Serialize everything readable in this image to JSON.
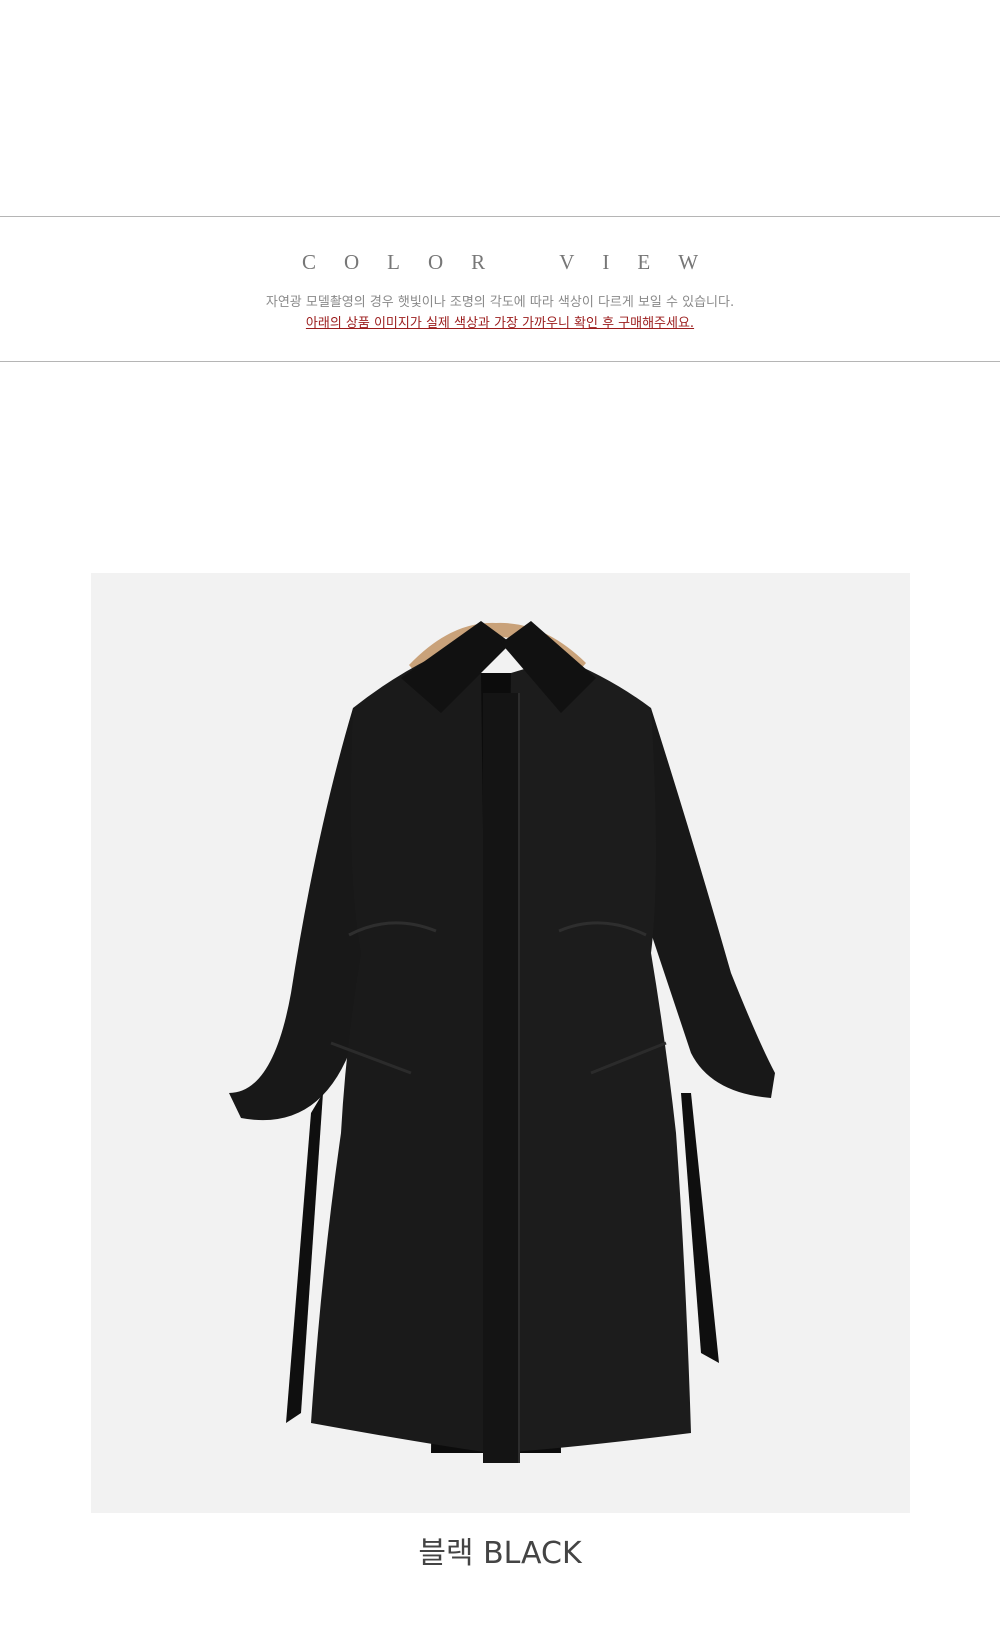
{
  "section": {
    "heading_words": [
      [
        "C",
        "O",
        "L",
        "O",
        "R"
      ],
      [
        "V",
        "I",
        "E",
        "W"
      ]
    ],
    "note_line1": "자연광 모델촬영의 경우 햇빛이나 조명의 각도에 따라 색상이 다르게 보일 수 있습니다.",
    "note_line2": "아래의 상품 이미지가 실제 색상과 가장 가까우니 확인 후 구매해주세요."
  },
  "product": {
    "caption": "블랙 BLACK",
    "image_subject": "black padded long coat on wooden hanger",
    "colors": {
      "background": "#f2f2f2",
      "coat": "#151515",
      "hanger": "#c9a27a"
    }
  }
}
